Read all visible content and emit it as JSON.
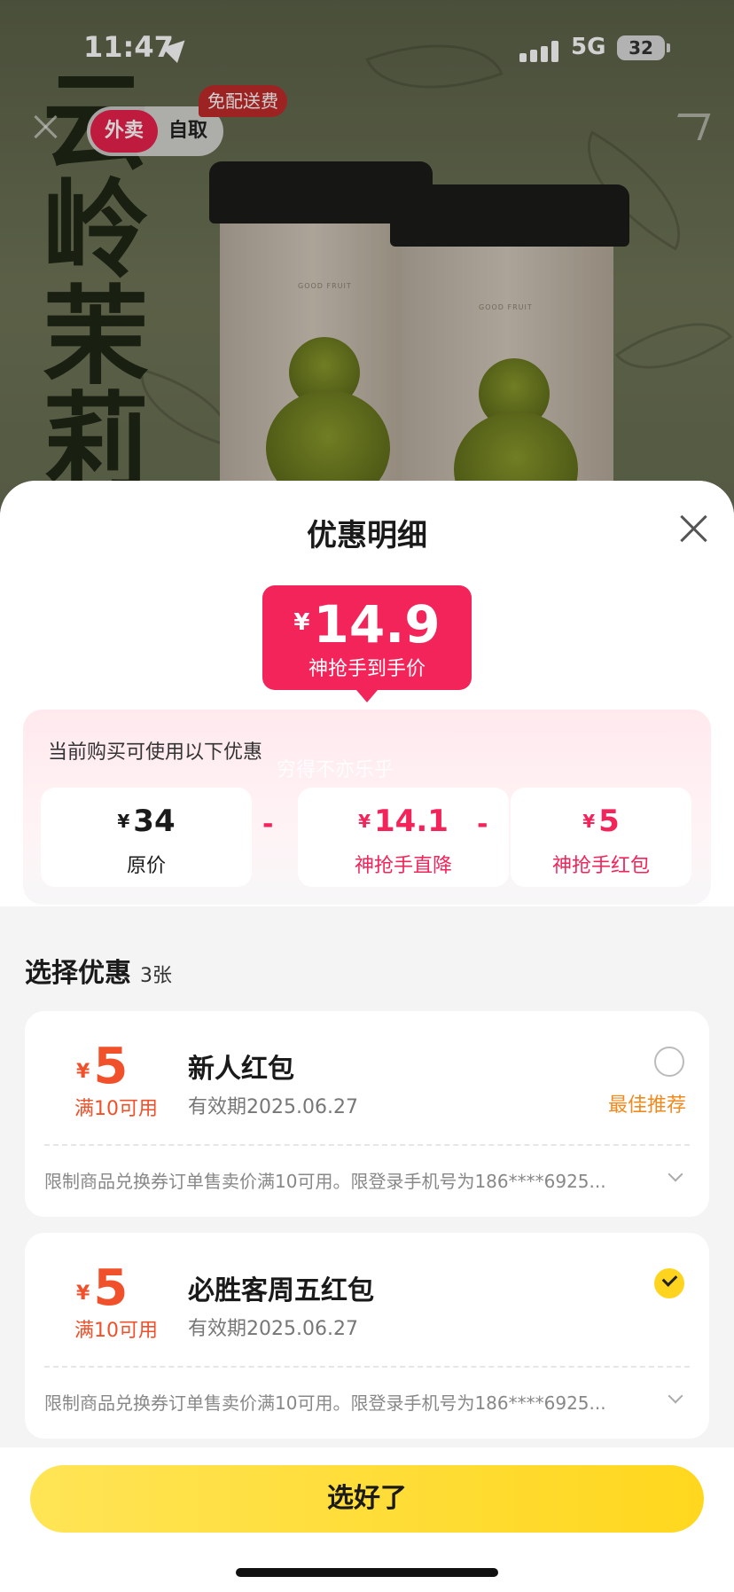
{
  "status_bar": {
    "time": "11:47",
    "network": "5G",
    "battery": "32"
  },
  "header": {
    "mode_active": "外卖",
    "mode_other": "自取",
    "free_delivery_badge": "免配送费"
  },
  "product_image": {
    "title_chars": [
      "云",
      "岭",
      "茉",
      "莉"
    ],
    "cup_brand": "GOOD FRUIT"
  },
  "sheet": {
    "title": "优惠明细",
    "final_price": {
      "currency": "¥",
      "value": "14.9",
      "label": "神抢手到手价"
    },
    "calc": {
      "intro": "当前购买可使用以下优惠",
      "watermark": "穷得不亦乐乎",
      "items": [
        {
          "currency": "¥",
          "value": "34",
          "label": "原价"
        },
        {
          "currency": "¥",
          "value": "14.1",
          "label": "神抢手直降"
        },
        {
          "currency": "¥",
          "value": "5",
          "label": "神抢手红包"
        }
      ],
      "operator": "-"
    },
    "choose": {
      "title": "选择优惠",
      "count": "3张"
    },
    "coupons": [
      {
        "currency": "¥",
        "amount": "5",
        "condition": "满10可用",
        "name": "新人红包",
        "expiry": "有效期2025.06.27",
        "tag": "最佳推荐",
        "selected": false,
        "desc": "限制商品兑换券订单售卖价满10可用。限登录手机号为186****6925..."
      },
      {
        "currency": "¥",
        "amount": "5",
        "condition": "满10可用",
        "name": "必胜客周五红包",
        "expiry": "有效期2025.06.27",
        "tag": "",
        "selected": true,
        "desc": "限制商品兑换券订单售卖价满10可用。限登录手机号为186****6925..."
      }
    ],
    "confirm_label": "选好了"
  },
  "colors": {
    "accent_red": "#f3245a",
    "coupon_orange": "#f0502a",
    "confirm_yellow": "#ffd71e"
  }
}
